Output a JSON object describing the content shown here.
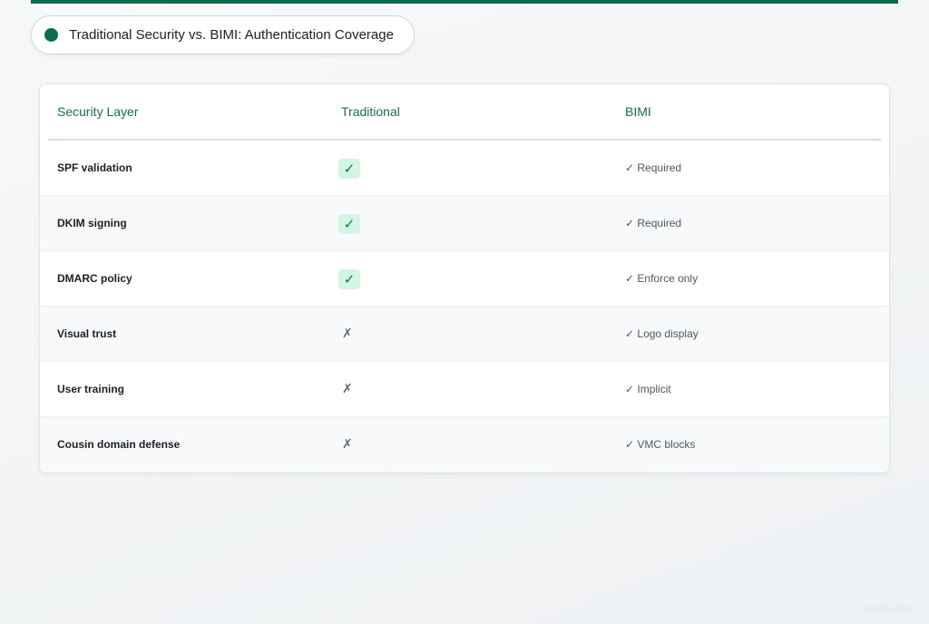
{
  "title": "Traditional Security vs. BIMI: Authentication Coverage",
  "colors": {
    "accent": "#0d6b52",
    "header_text": "#1a6e54",
    "check_badge_bg": "#d3f5e4",
    "check_mark": "#0c7a4e",
    "cross_mark": "#5d6b76"
  },
  "table": {
    "headers": [
      "Security Layer",
      "Traditional",
      "BIMI"
    ],
    "rows": [
      {
        "layer": "SPF validation",
        "traditional": "✓",
        "traditional_status": "check",
        "bimi": "✓ Required"
      },
      {
        "layer": "DKIM signing",
        "traditional": "✓",
        "traditional_status": "check",
        "bimi": "✓ Required"
      },
      {
        "layer": "DMARC policy",
        "traditional": "✓",
        "traditional_status": "check",
        "bimi": "✓ Enforce only"
      },
      {
        "layer": "Visual trust",
        "traditional": "✗",
        "traditional_status": "cross",
        "bimi": "✓ Logo display"
      },
      {
        "layer": "User training",
        "traditional": "✗",
        "traditional_status": "cross",
        "bimi": "✓ Implicit"
      },
      {
        "layer": "Cousin domain defense",
        "traditional": "✗",
        "traditional_status": "cross",
        "bimi": "✓ VMC blocks"
      }
    ]
  },
  "watermark": "skysnag.com"
}
